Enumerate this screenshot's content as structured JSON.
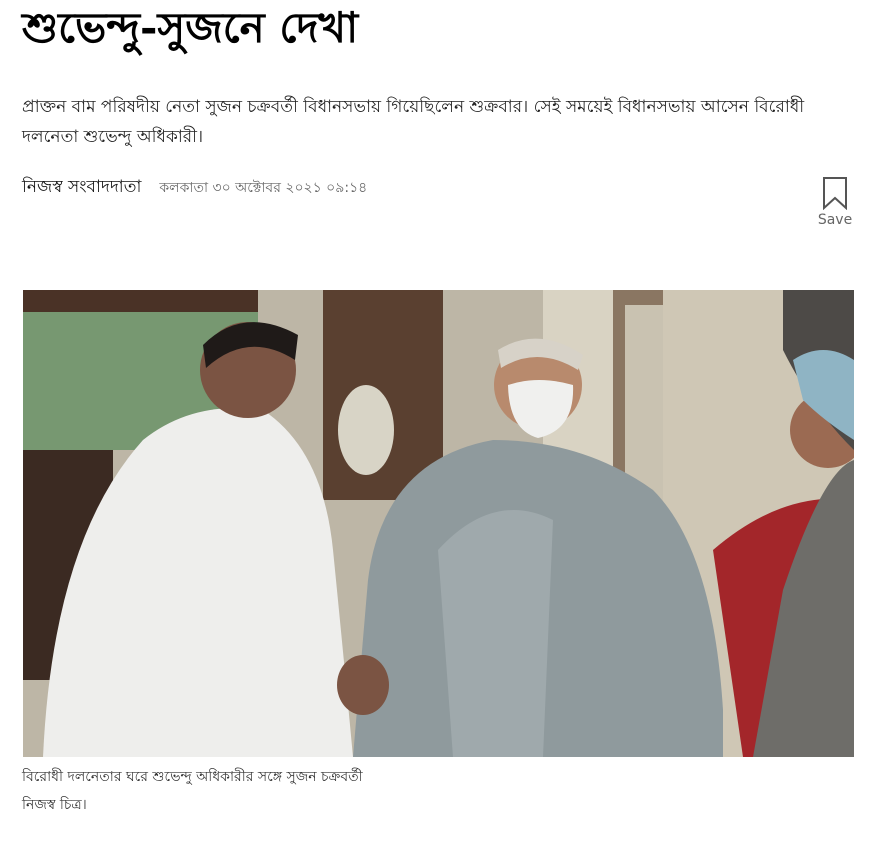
{
  "article": {
    "headline": "শুভেন্দু-সুজনে দেখা",
    "subheadline": "প্রাক্তন বাম পরিষদীয় নেতা সুজন চক্রবর্তী বিধানসভায় গিয়েছিলেন শুক্রবার। সেই সময়েই বিধানসভায় আসেন বিরোধী দলনেতা শুভেন্দু অধিকারী।",
    "author": "নিজস্ব সংবাদদাতা",
    "dateline": "কলকাতা ৩০ অক্টোবর ২০২১ ০৯:১৪",
    "save": {
      "label": "Save",
      "icon": "bookmark-icon"
    },
    "photo": {
      "caption": "বিরোধী দলনেতার ঘরে শুভেন্দু অধিকারীর সঙ্গে সুজন চক্রবর্তী",
      "credit": "নিজস্ব চিত্র।"
    }
  },
  "colors": {
    "text": "#111111",
    "muted": "#666666",
    "icon": "#555555"
  }
}
